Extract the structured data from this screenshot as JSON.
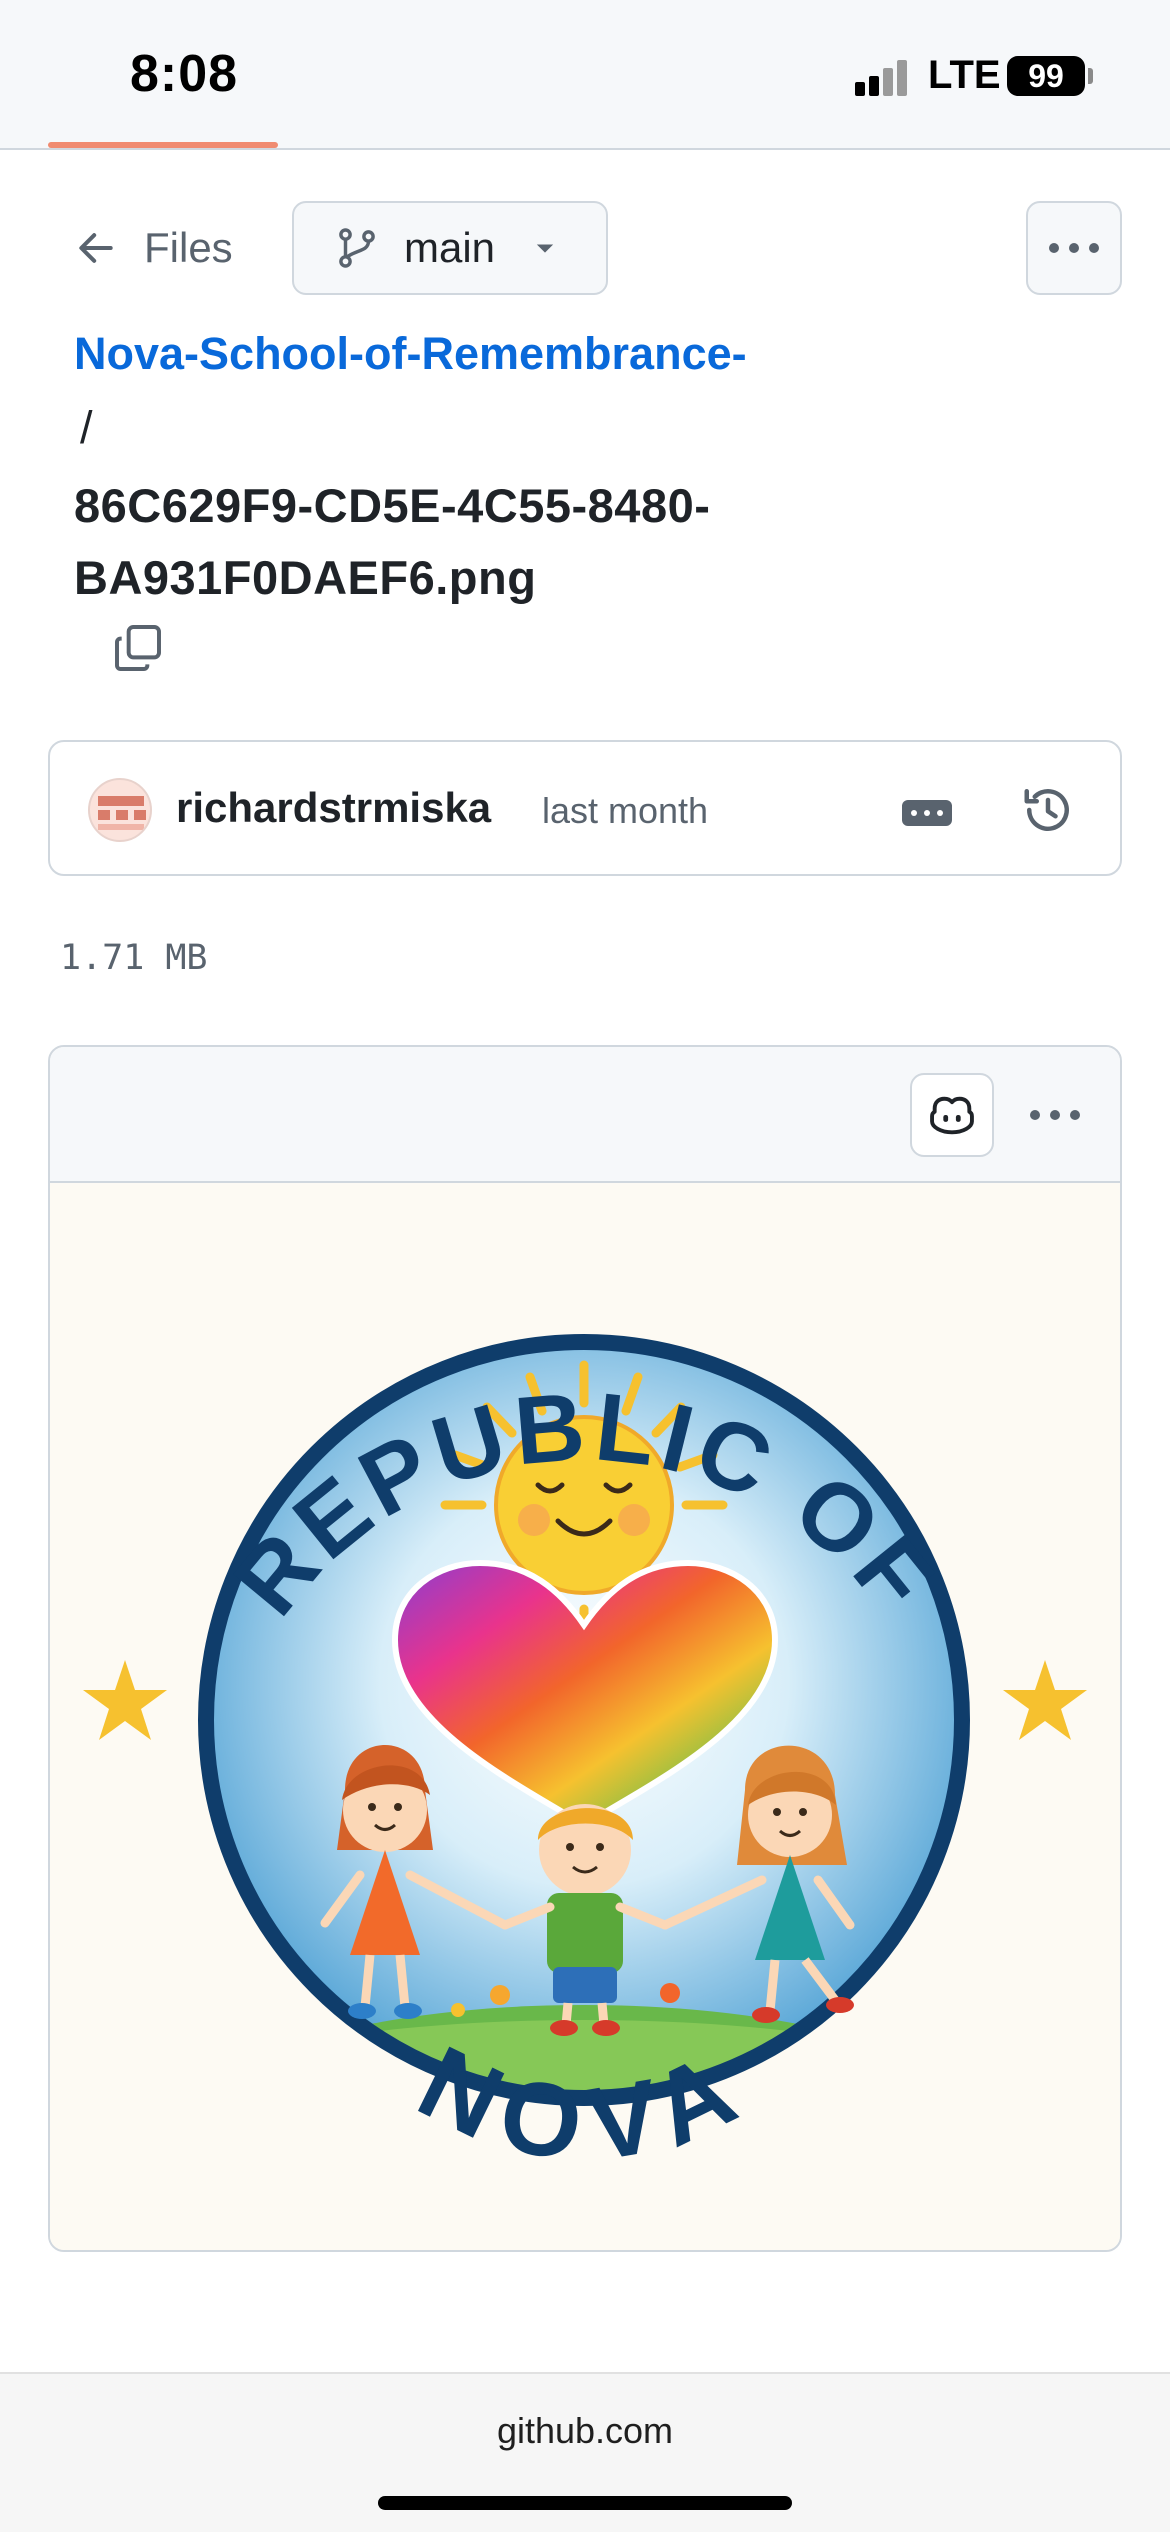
{
  "status_bar": {
    "time": "8:08",
    "network": "LTE",
    "battery": "99"
  },
  "nav": {
    "back_label": "Files",
    "branch": "main"
  },
  "breadcrumb": {
    "repo": "Nova-School-of-Remembrance-",
    "separator": "/",
    "file_line1": "86C629F9-CD5E-4C55-8480-",
    "file_line2": "BA931F0DAEF6.png"
  },
  "commit": {
    "author": "richardstrmiska",
    "time": "last month"
  },
  "file": {
    "size": "1.71 MB"
  },
  "image": {
    "arc_top": "REPUBLIC OF",
    "arc_bottom": "NOVA"
  },
  "browser": {
    "url": "github.com"
  },
  "colors": {
    "link": "#0969da",
    "border": "#d0d7de",
    "muted": "#59636e",
    "seal_navy": "#0f3d6b"
  }
}
